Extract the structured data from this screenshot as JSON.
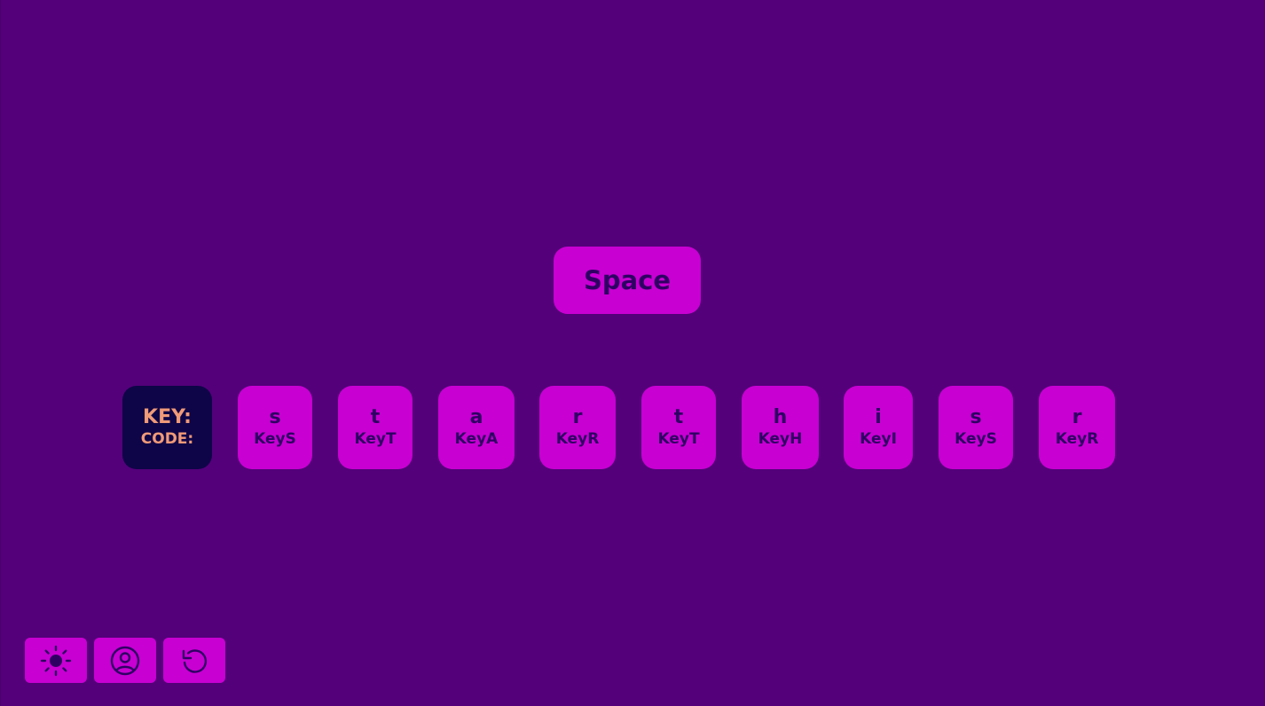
{
  "current_key": "Space",
  "legend": {
    "key_label": "KEY:",
    "code_label": "CODE:"
  },
  "history": [
    {
      "key": "s",
      "code": "KeyS"
    },
    {
      "key": "t",
      "code": "KeyT"
    },
    {
      "key": "a",
      "code": "KeyA"
    },
    {
      "key": "r",
      "code": "KeyR"
    },
    {
      "key": "t",
      "code": "KeyT"
    },
    {
      "key": "h",
      "code": "KeyH"
    },
    {
      "key": "i",
      "code": "KeyI"
    },
    {
      "key": "s",
      "code": "KeyS"
    },
    {
      "key": "r",
      "code": "KeyR"
    }
  ],
  "toolbar": [
    {
      "icon": "sun-icon"
    },
    {
      "icon": "user-circle-icon"
    },
    {
      "icon": "rotate-ccw-icon"
    }
  ],
  "colors": {
    "background": "#54007a",
    "tile": "#c800d2",
    "tile_text": "#2f0064",
    "legend_bg": "#0e0548",
    "legend_text": "#f09a78"
  }
}
